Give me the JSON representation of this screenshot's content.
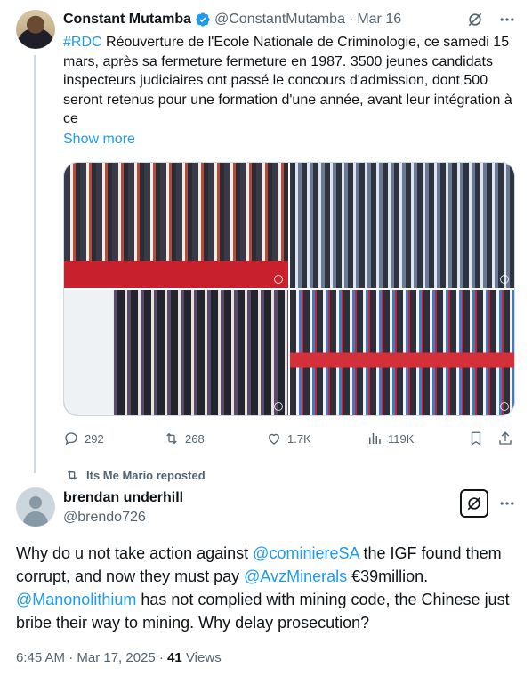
{
  "tweet1": {
    "name": "Constant Mutamba",
    "handle": "@ConstantMutamba",
    "time_sep": "·",
    "date": "Mar 16",
    "hashtag": "#RDC",
    "text": " Réouverture  de l'Ecole Nationale de Criminologie, ce samedi 15 mars, après sa fermeture fermeture en 1987. 3500 jeunes candidats inspecteurs judiciaires ont passé le concours d'admission, dont 500 seront retenus pour une formation d'une année, avant leur intégration à ce",
    "show_more": "Show more",
    "stats": {
      "replies": "292",
      "reposts": "268",
      "likes": "1.7K",
      "views": "119K"
    }
  },
  "repost_label": "Its Me Mario reposted",
  "tweet2": {
    "name": "brendan underhill",
    "handle": "@brendo726",
    "text_1": "Why do u not take action against ",
    "mention_1": "@cominiereSA",
    "text_2": " the IGF found them corrupt, and now they must pay ",
    "mention_2": "@AvzMinerals",
    "text_3": " €39million. ",
    "mention_3": "@Manonolithium",
    "text_4": " has not complied with mining code, the Chinese just bribe their way to mining. Why delay prosecution?",
    "timestamp": "6:45 AM · Mar 17, 2025 · ",
    "views_count": "41",
    "views_label": " Views"
  },
  "colors": {
    "accent": "#1d9bf0",
    "muted": "#536471",
    "text": "#0f1419"
  }
}
